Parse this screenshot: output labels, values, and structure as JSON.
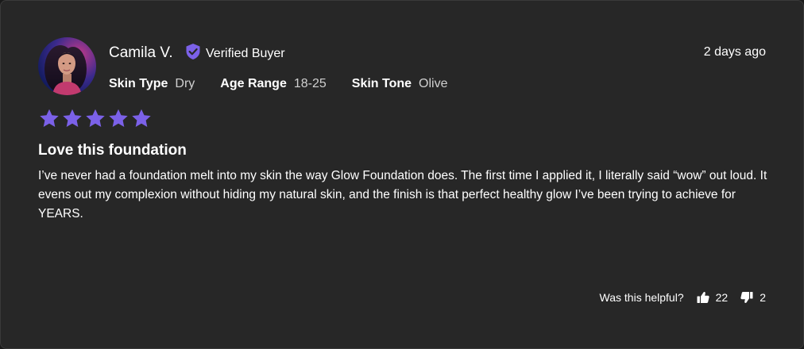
{
  "review": {
    "reviewer_name": "Camila V.",
    "verified_label": "Verified Buyer",
    "timestamp": "2 days ago",
    "attributes": [
      {
        "label": "Skin Type",
        "value": "Dry"
      },
      {
        "label": "Age Range",
        "value": "18-25"
      },
      {
        "label": "Skin Tone",
        "value": "Olive"
      }
    ],
    "rating": 5,
    "rating_max": 5,
    "title": "Love this foundation",
    "body": "I’ve never had a foundation melt into my skin the way Glow Foundation does. The first time I applied it, I literally said “wow” out loud. It evens out my complexion without hiding my natural skin, and the finish is that perfect healthy glow I’ve been trying to achieve for YEARS.",
    "helpful_question": "Was this helpful?",
    "helpful_up_count": "22",
    "helpful_down_count": "2"
  },
  "icons": {
    "verified": "shield-check-icon",
    "star": "star-icon",
    "thumbs_up": "thumbs-up-icon",
    "thumbs_down": "thumbs-down-icon"
  },
  "colors": {
    "card_background": "#272727",
    "accent": "#7b61e8",
    "text": "#ffffff",
    "muted_text": "#d0d0d0"
  }
}
